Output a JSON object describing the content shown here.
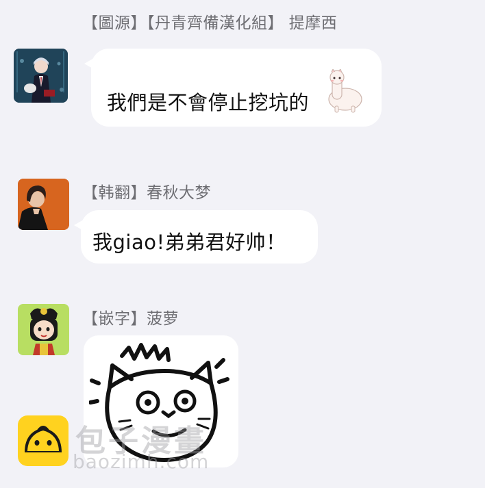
{
  "messages": [
    {
      "sender": "【圖源】【丹青齊備漢化組】 提摩西",
      "text": "我們是不會停止挖坑的",
      "emoji_icon": "alpaca-icon"
    },
    {
      "sender": "【韩翻】春秋大梦",
      "text": "我giao!弟弟君好帅！"
    },
    {
      "sender": "【嵌字】菠萝",
      "sticker_icon": "angry-cat-sticker-icon"
    }
  ],
  "watermark": {
    "title": "包子漫畫",
    "domain": "baozimh.com",
    "logo_icon": "bun-logo-icon"
  },
  "colors": {
    "background": "#f2f2f7",
    "bubble": "#ffffff",
    "sender_text": "#6e6e73",
    "message_text": "#111111",
    "logo_yellow": "#ffd21f"
  }
}
